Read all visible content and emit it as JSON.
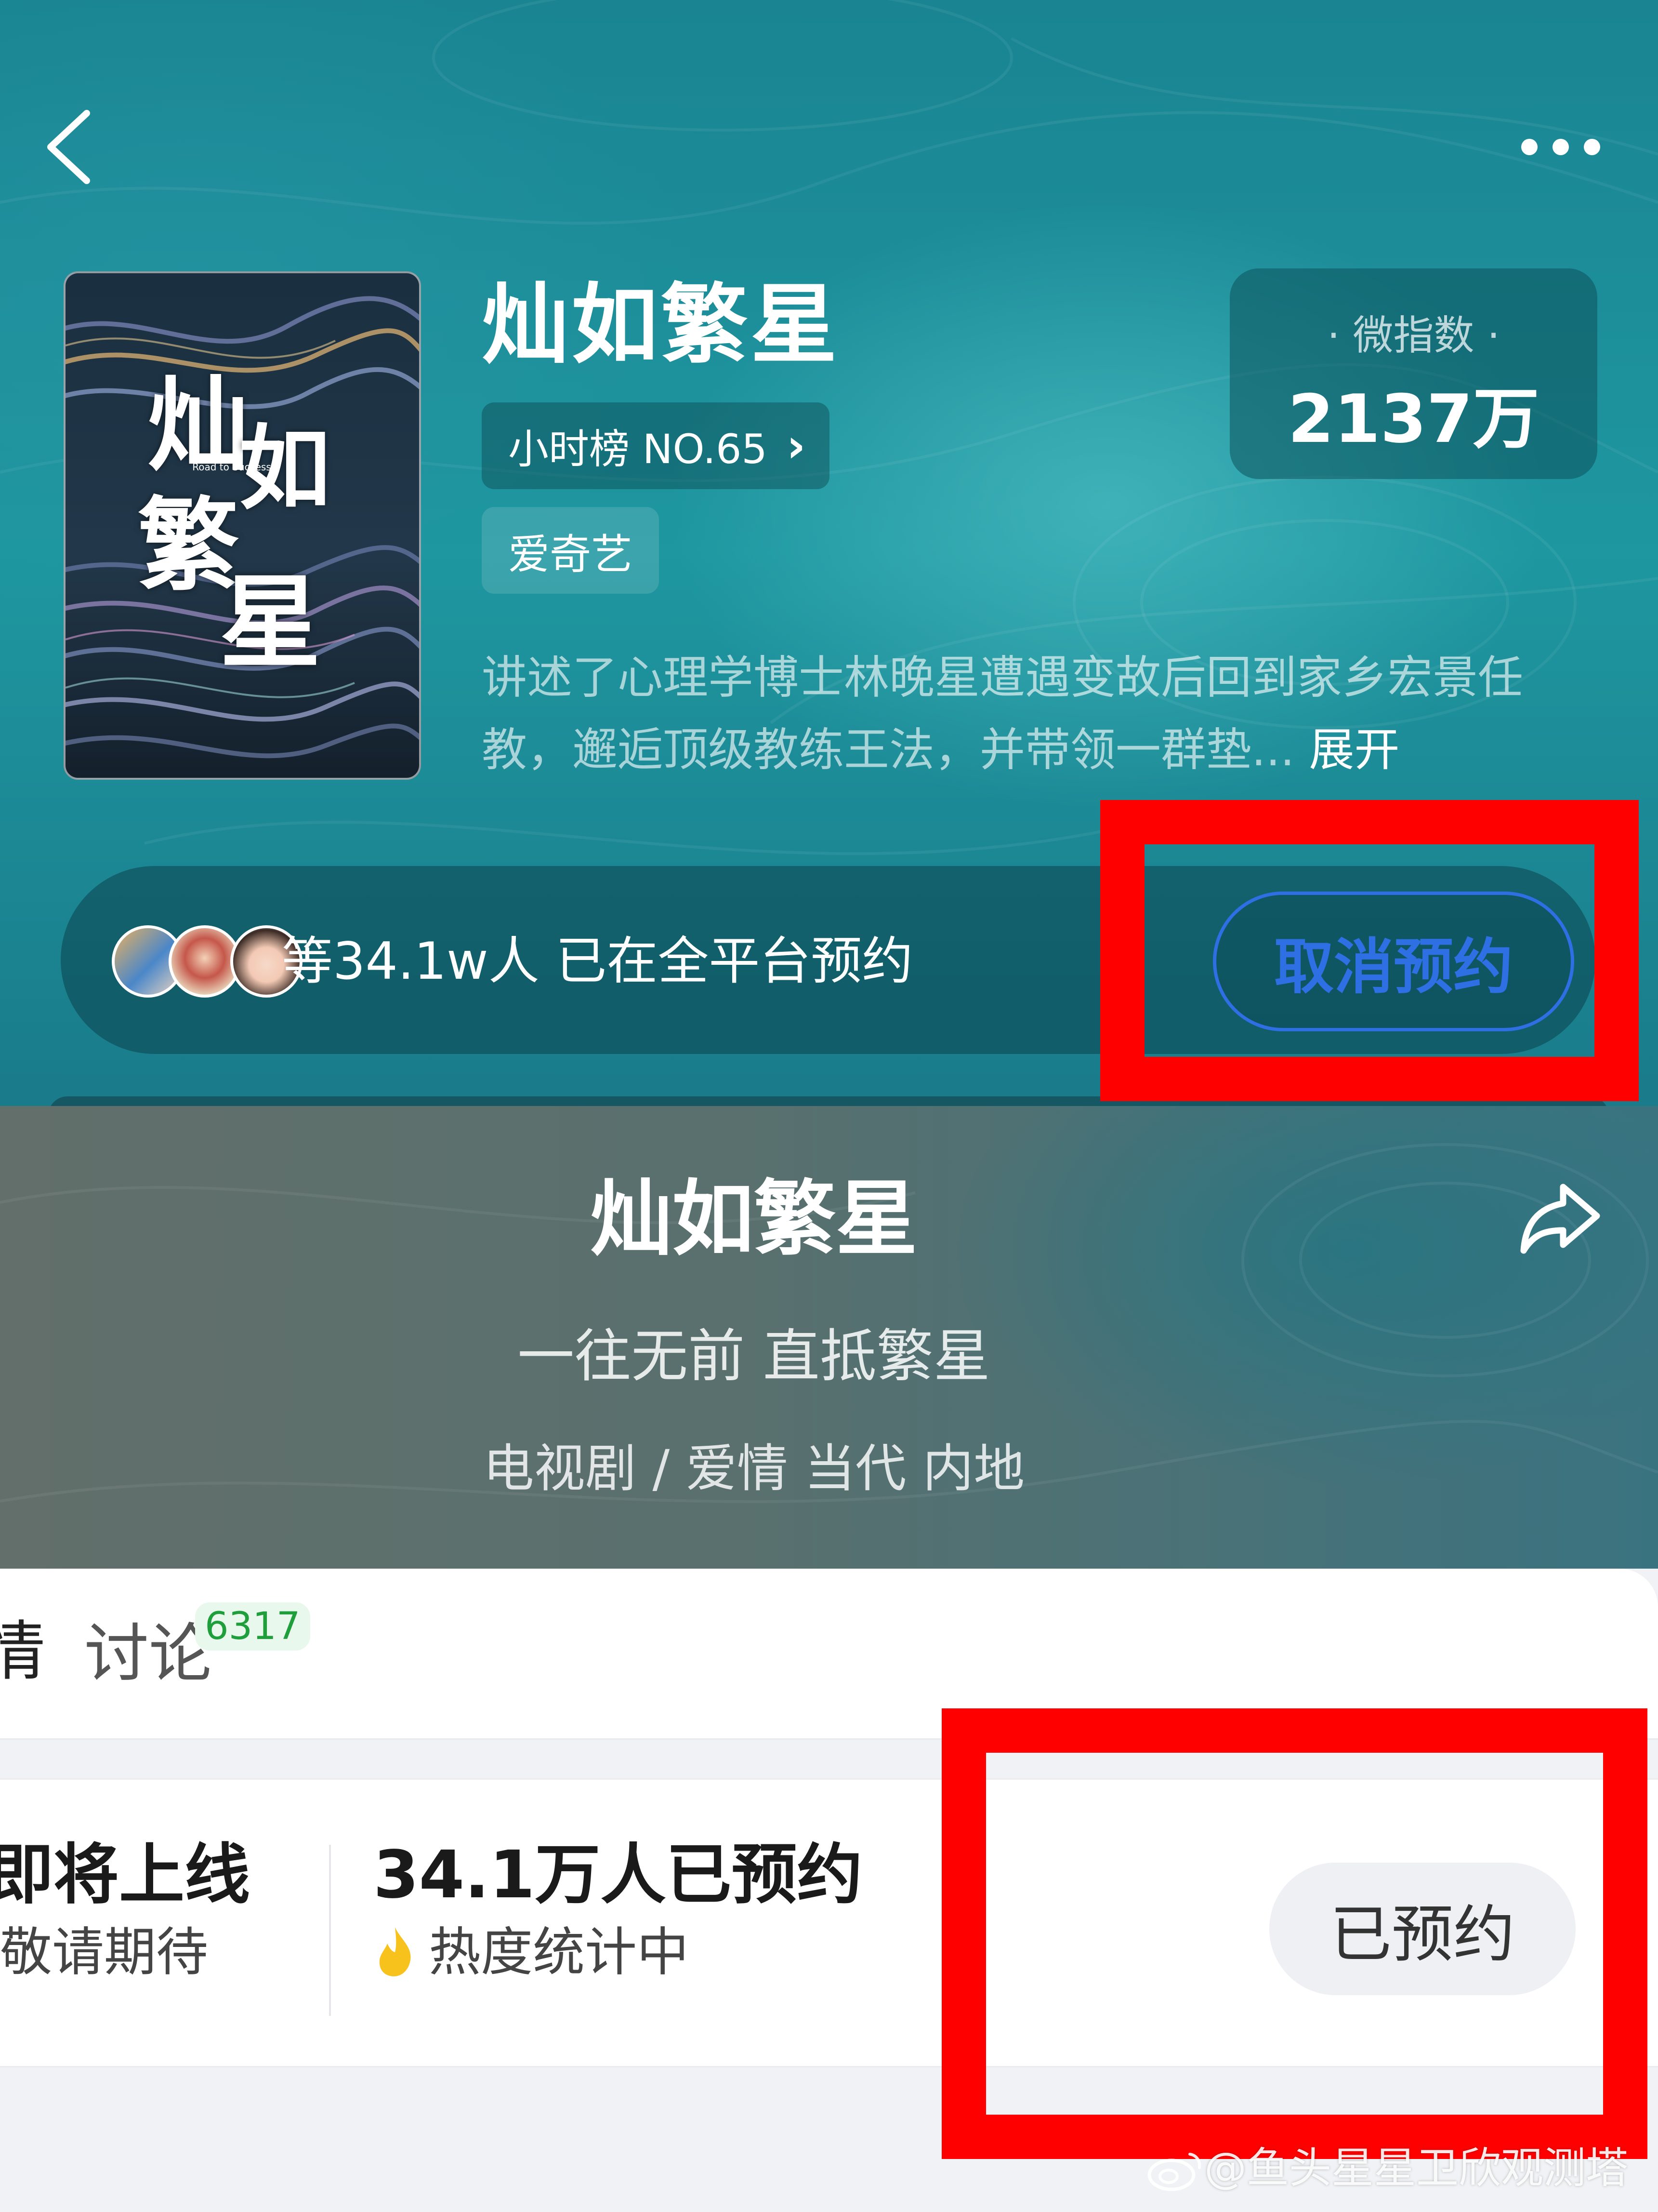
{
  "header": {
    "back_icon": "chevron-left-icon",
    "more_icon": "more-dots-icon"
  },
  "poster": {
    "title_chars": [
      "灿",
      "如",
      "繁",
      "星"
    ],
    "subtitle": "Road to Success"
  },
  "show": {
    "title": "灿如繁星",
    "rank_label": "小时榜 NO.65",
    "rank_chevron": "›",
    "platform": "爱奇艺",
    "weiindex_label": "· 微指数 ·",
    "weiindex_value": "2137万",
    "synopsis": "讲述了心理学博士林晚星遭遇变故后回到家乡宏景任教，邂逅顶级教练王法，并带领一群垫...",
    "expand_label": "展开"
  },
  "reservation_bar": {
    "text": "等34.1w人 已在全平台预约",
    "cancel_label": "取消预约",
    "accent": "#2f6fe4"
  },
  "detail": {
    "title": "灿如繁星",
    "tagline": "一往无前 直抵繁星",
    "genre": "电视剧 / 爱情 当代 内地",
    "share_icon": "share-arrow-icon"
  },
  "tabs": {
    "partial_tab": "情",
    "discuss_label": "讨论",
    "discuss_count": "6317"
  },
  "stats": {
    "upcoming_main": "即将上线",
    "upcoming_sub": "敬请期待",
    "reserved_count": "34.1万人已预约",
    "heat_text": "热度统计中",
    "reserved_button": "已预约"
  },
  "watermark": {
    "text": "@鱼头星星卫欣观测塔"
  },
  "colors": {
    "highlight_red": "#ff0000",
    "teal_bg": "#1e97a0"
  }
}
